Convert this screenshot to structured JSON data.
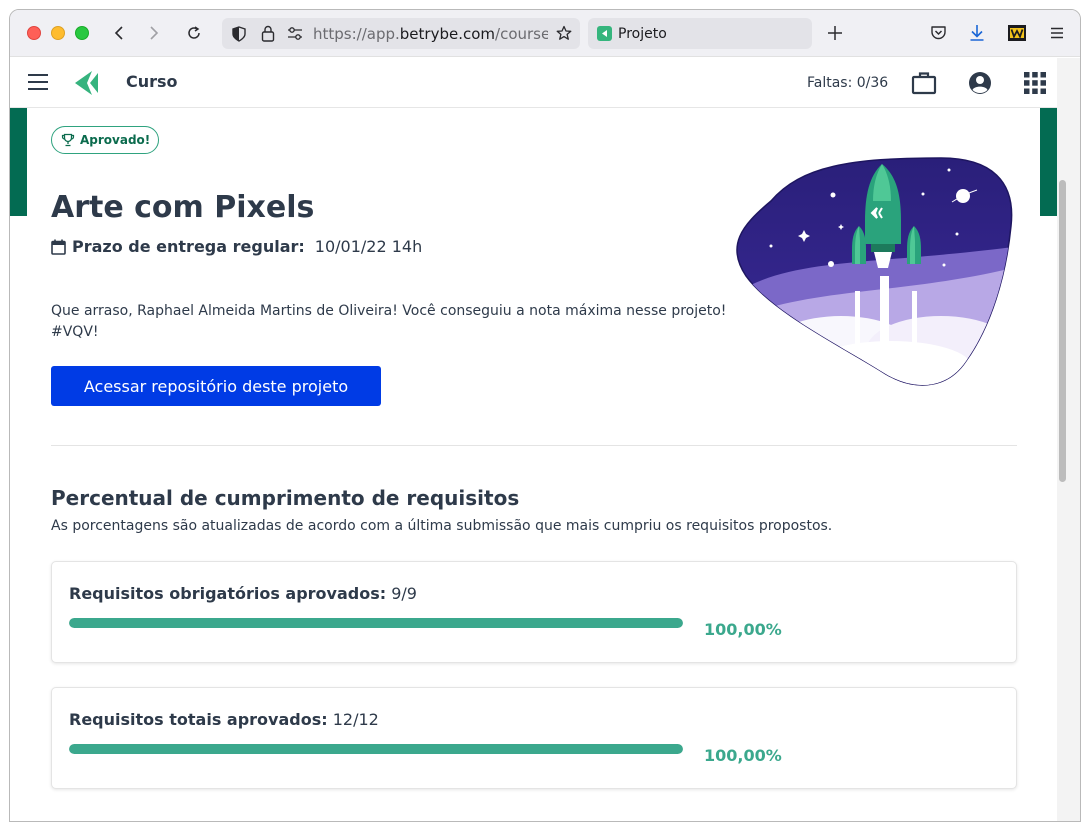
{
  "browser": {
    "url_prefix": "https://app.",
    "url_host": "betrybe.com",
    "url_suffix": "/course/p",
    "tab_title": "Projeto"
  },
  "header": {
    "course_title": "Curso",
    "faltas": "Faltas: 0/36"
  },
  "project": {
    "badge": "Aprovado!",
    "title": "Arte com Pixels",
    "deadline_label": "Prazo de entrega regular:",
    "deadline_value": "10/01/22 14h",
    "congrats_line1": "Que arraso, Raphael Almeida Martins de Oliveira! Você conseguiu a nota máxima nesse projeto!",
    "congrats_line2": "#VQV!",
    "repo_button": "Acessar repositório deste projeto"
  },
  "requirements": {
    "title": "Percentual de cumprimento de requisitos",
    "subtitle": "As porcentagens são atualizadas de acordo com a última submissão que mais cumpriu os requisitos propostos.",
    "items": [
      {
        "label": "Requisitos obrigatórios aprovados:",
        "value": "9/9",
        "percent_text": "100,00%",
        "fraction": 1.0
      },
      {
        "label": "Requisitos totais aprovados:",
        "value": "12/12",
        "percent_text": "100,00%",
        "fraction": 1.0
      }
    ]
  },
  "colors": {
    "brand_green": "#036b52",
    "progress_green": "#3ba88d",
    "button_blue": "#003be5"
  }
}
